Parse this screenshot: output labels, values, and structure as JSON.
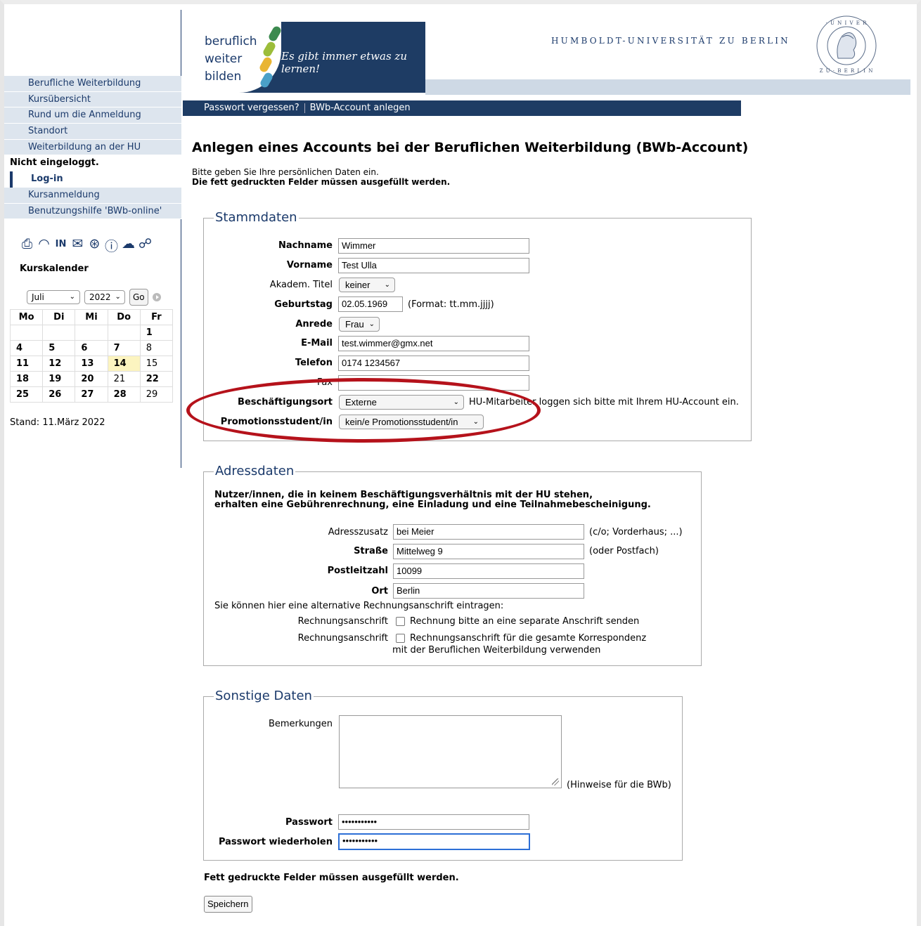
{
  "header": {
    "logo_line1": "beruflich",
    "logo_line2": "weiter",
    "logo_line3": "bilden",
    "slogan": "Es gibt immer etwas zu lernen!",
    "university": "HUMBOLDT-UNIVERSITÄT ZU BERLIN",
    "topbar": {
      "forgot": "Passwort vergessen?",
      "create": "BWb-Account anlegen"
    },
    "colors": {
      "navy": "#1e3c64",
      "band": "#ced9e5"
    }
  },
  "sidebar": {
    "items": [
      "Berufliche Weiterbildung",
      "Kursübersicht",
      "Rund um die Anmeldung",
      "Standort",
      "Weiterbildung an der HU"
    ],
    "status": "Nicht eingeloggt.",
    "active": "Log-in",
    "items2": [
      "Kursanmeldung",
      "Benutzungshilfe 'BWb-online'"
    ],
    "icons": [
      "printer-icon",
      "rss-icon",
      "hu-in-icon",
      "mail-icon",
      "accessibility-icon",
      "info-icon",
      "cloud-lock-icon",
      "link-icon"
    ],
    "calendar": {
      "title": "Kurskalender",
      "month": "Juli",
      "year": "2022",
      "go": "Go",
      "days": [
        "Mo",
        "Di",
        "Mi",
        "Do",
        "Fr"
      ],
      "weeks": [
        [
          "",
          "",
          "",
          "",
          "1"
        ],
        [
          "4",
          "5",
          "6",
          "7",
          "8"
        ],
        [
          "11",
          "12",
          "13",
          "14",
          "15"
        ],
        [
          "18",
          "19",
          "20",
          "21",
          "22"
        ],
        [
          "25",
          "26",
          "27",
          "28",
          "29"
        ]
      ],
      "today": "14"
    },
    "stand": "Stand: 11.März 2022"
  },
  "main": {
    "title": "Anlegen eines Accounts bei der Beruflichen Weiterbildung (BWb-Account)",
    "intro1": "Bitte geben Sie Ihre persönlichen Daten ein.",
    "intro2": "Die fett gedruckten Felder müssen ausgefüllt werden.",
    "stamm": {
      "legend": "Stammdaten",
      "nachname_label": "Nachname",
      "nachname": "Wimmer",
      "vorname_label": "Vorname",
      "vorname": "Test Ulla",
      "titel_label": "Akadem. Titel",
      "titel": "keiner",
      "geburtstag_label": "Geburtstag",
      "geburtstag": "02.05.1969",
      "geburtstag_hint": "(Format: tt.mm.jjjj)",
      "anrede_label": "Anrede",
      "anrede": "Frau",
      "email_label": "E-Mail",
      "email": "test.wimmer@gmx.net",
      "telefon_label": "Telefon",
      "telefon": "0174 1234567",
      "fax_label": "Fax",
      "fax": "",
      "beschaeftigung_label": "Beschäftigungsort",
      "beschaeftigung": "Externe",
      "beschaeftigung_hint": "HU-Mitarbeiter loggen sich bitte mit Ihrem HU-Account ein.",
      "promotion_label": "Promotionsstudent/in",
      "promotion": "kein/e Promotionsstudent/in"
    },
    "adress": {
      "legend": "Adressdaten",
      "note1": "Nutzer/innen, die in keinem Beschäftigungsverhältnis mit der HU stehen,",
      "note2": "erhalten eine Gebührenrechnung, eine Einladung und eine Teilnahmebescheinigung.",
      "zusatz_label": "Adresszusatz",
      "zusatz": "bei Meier",
      "zusatz_hint": "(c/o; Vorderhaus; ...)",
      "strasse_label": "Straße",
      "strasse": "Mittelweg 9",
      "strasse_hint": "(oder Postfach)",
      "plz_label": "Postleitzahl",
      "plz": "10099",
      "ort_label": "Ort",
      "ort": "Berlin",
      "alt_note": "Sie können hier eine alternative Rechnungsanschrift eintragen:",
      "rechnung_label": "Rechnungsanschrift",
      "rechnung1": "Rechnung bitte an eine separate Anschrift senden",
      "rechnung2a": "Rechnungsanschrift für die gesamte Korrespondenz",
      "rechnung2b": "mit der Beruflichen Weiterbildung verwenden"
    },
    "sonstige": {
      "legend": "Sonstige Daten",
      "bemerkungen_label": "Bemerkungen",
      "bemerkungen_hint": "(Hinweise für die BWb)",
      "passwort_label": "Passwort",
      "passwort": "•••••••••••",
      "passwort2_label": "Passwort wiederholen",
      "passwort2": "•••••••••••"
    },
    "footer_note": "Fett gedruckte Felder müssen ausgefüllt werden.",
    "save": "Speichern"
  },
  "annotation_color": "#b5121b"
}
